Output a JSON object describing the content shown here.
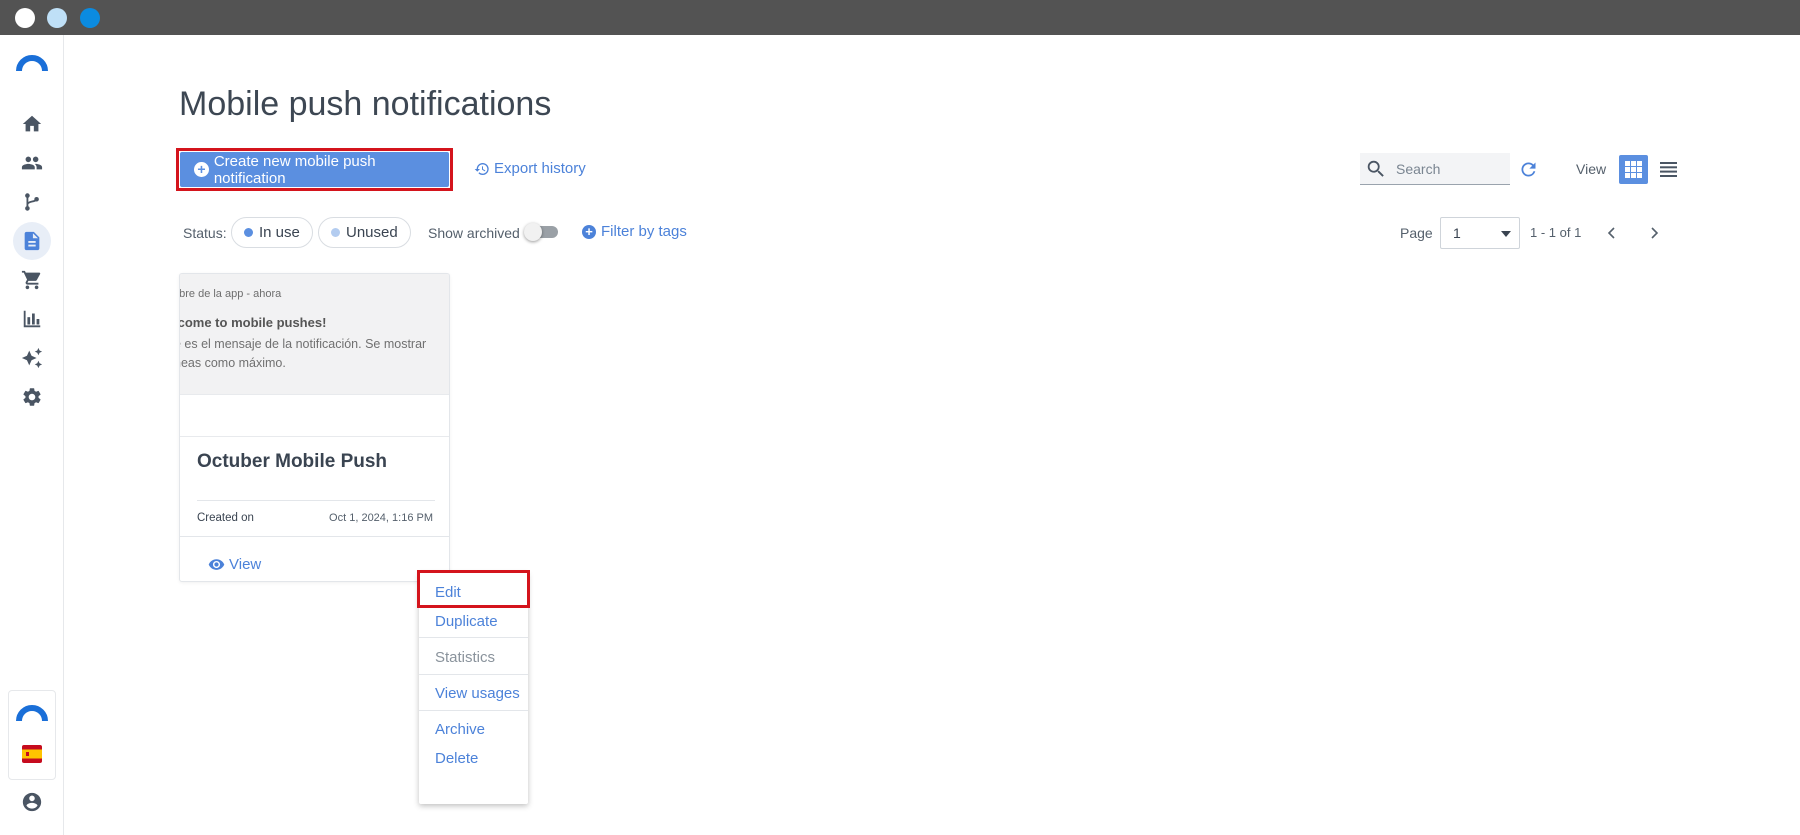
{
  "window": {
    "dot_colors": [
      "#ffffff",
      "#bfe0f7",
      "#0b8be0"
    ]
  },
  "sidebar": {
    "items": [
      {
        "name": "home-icon"
      },
      {
        "name": "people-icon"
      },
      {
        "name": "flow-icon"
      },
      {
        "name": "document-icon",
        "active": true
      },
      {
        "name": "cart-icon"
      },
      {
        "name": "bar-chart-icon"
      },
      {
        "name": "sparkles-icon"
      },
      {
        "name": "gear-icon"
      }
    ],
    "bottom": [
      "brand-logo-icon",
      "spain-flag-icon",
      "account-icon"
    ]
  },
  "header": {
    "title": "Mobile push notifications",
    "create_button": "Create new mobile push notification",
    "export_link": "Export history",
    "search_placeholder": "Search",
    "view_label": "View"
  },
  "filters": {
    "status_label": "Status:",
    "in_use": "In use",
    "unused": "Unused",
    "in_use_color": "#5b8fe0",
    "unused_color": "#b3ccf0",
    "show_archived": "Show archived",
    "filter_by_tags": "Filter by tags"
  },
  "pagination": {
    "page_label": "Page",
    "page_value": "1",
    "range": "1 - 1 of 1"
  },
  "card": {
    "preview": {
      "app_line": "nbre de la app - ahora",
      "title": "lcome to mobile pushes!",
      "body_line1": "e es el mensaje de la notificación. Se mostrar",
      "body_line2": "neas como máximo."
    },
    "name": "Octuber Mobile Push",
    "created_label": "Created on",
    "created_date": "Oct 1, 2024, 1:16 PM",
    "view_label": "View"
  },
  "context_menu": {
    "items": [
      "Edit",
      "Duplicate",
      "Statistics",
      "View usages",
      "Archive",
      "Delete"
    ]
  },
  "colors": {
    "accent": "#5b8fe0",
    "link": "#4c82d9",
    "highlight": "#d4141c"
  }
}
